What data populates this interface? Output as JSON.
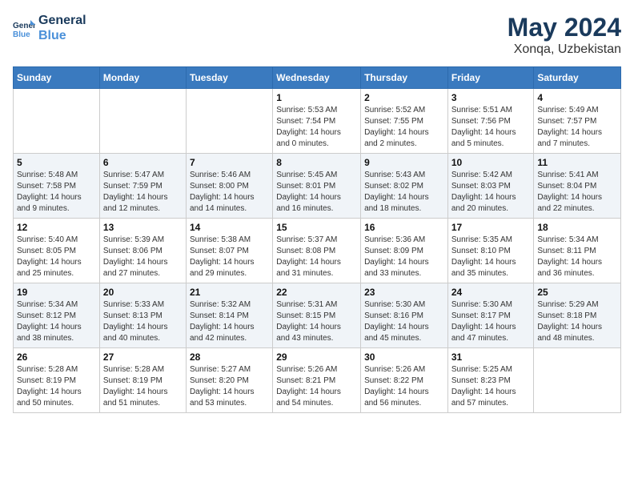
{
  "header": {
    "logo_line1": "General",
    "logo_line2": "Blue",
    "month": "May 2024",
    "location": "Xonqa, Uzbekistan"
  },
  "days_of_week": [
    "Sunday",
    "Monday",
    "Tuesday",
    "Wednesday",
    "Thursday",
    "Friday",
    "Saturday"
  ],
  "weeks": [
    [
      {
        "day": "",
        "info": ""
      },
      {
        "day": "",
        "info": ""
      },
      {
        "day": "",
        "info": ""
      },
      {
        "day": "1",
        "info": "Sunrise: 5:53 AM\nSunset: 7:54 PM\nDaylight: 14 hours\nand 0 minutes."
      },
      {
        "day": "2",
        "info": "Sunrise: 5:52 AM\nSunset: 7:55 PM\nDaylight: 14 hours\nand 2 minutes."
      },
      {
        "day": "3",
        "info": "Sunrise: 5:51 AM\nSunset: 7:56 PM\nDaylight: 14 hours\nand 5 minutes."
      },
      {
        "day": "4",
        "info": "Sunrise: 5:49 AM\nSunset: 7:57 PM\nDaylight: 14 hours\nand 7 minutes."
      }
    ],
    [
      {
        "day": "5",
        "info": "Sunrise: 5:48 AM\nSunset: 7:58 PM\nDaylight: 14 hours\nand 9 minutes."
      },
      {
        "day": "6",
        "info": "Sunrise: 5:47 AM\nSunset: 7:59 PM\nDaylight: 14 hours\nand 12 minutes."
      },
      {
        "day": "7",
        "info": "Sunrise: 5:46 AM\nSunset: 8:00 PM\nDaylight: 14 hours\nand 14 minutes."
      },
      {
        "day": "8",
        "info": "Sunrise: 5:45 AM\nSunset: 8:01 PM\nDaylight: 14 hours\nand 16 minutes."
      },
      {
        "day": "9",
        "info": "Sunrise: 5:43 AM\nSunset: 8:02 PM\nDaylight: 14 hours\nand 18 minutes."
      },
      {
        "day": "10",
        "info": "Sunrise: 5:42 AM\nSunset: 8:03 PM\nDaylight: 14 hours\nand 20 minutes."
      },
      {
        "day": "11",
        "info": "Sunrise: 5:41 AM\nSunset: 8:04 PM\nDaylight: 14 hours\nand 22 minutes."
      }
    ],
    [
      {
        "day": "12",
        "info": "Sunrise: 5:40 AM\nSunset: 8:05 PM\nDaylight: 14 hours\nand 25 minutes."
      },
      {
        "day": "13",
        "info": "Sunrise: 5:39 AM\nSunset: 8:06 PM\nDaylight: 14 hours\nand 27 minutes."
      },
      {
        "day": "14",
        "info": "Sunrise: 5:38 AM\nSunset: 8:07 PM\nDaylight: 14 hours\nand 29 minutes."
      },
      {
        "day": "15",
        "info": "Sunrise: 5:37 AM\nSunset: 8:08 PM\nDaylight: 14 hours\nand 31 minutes."
      },
      {
        "day": "16",
        "info": "Sunrise: 5:36 AM\nSunset: 8:09 PM\nDaylight: 14 hours\nand 33 minutes."
      },
      {
        "day": "17",
        "info": "Sunrise: 5:35 AM\nSunset: 8:10 PM\nDaylight: 14 hours\nand 35 minutes."
      },
      {
        "day": "18",
        "info": "Sunrise: 5:34 AM\nSunset: 8:11 PM\nDaylight: 14 hours\nand 36 minutes."
      }
    ],
    [
      {
        "day": "19",
        "info": "Sunrise: 5:34 AM\nSunset: 8:12 PM\nDaylight: 14 hours\nand 38 minutes."
      },
      {
        "day": "20",
        "info": "Sunrise: 5:33 AM\nSunset: 8:13 PM\nDaylight: 14 hours\nand 40 minutes."
      },
      {
        "day": "21",
        "info": "Sunrise: 5:32 AM\nSunset: 8:14 PM\nDaylight: 14 hours\nand 42 minutes."
      },
      {
        "day": "22",
        "info": "Sunrise: 5:31 AM\nSunset: 8:15 PM\nDaylight: 14 hours\nand 43 minutes."
      },
      {
        "day": "23",
        "info": "Sunrise: 5:30 AM\nSunset: 8:16 PM\nDaylight: 14 hours\nand 45 minutes."
      },
      {
        "day": "24",
        "info": "Sunrise: 5:30 AM\nSunset: 8:17 PM\nDaylight: 14 hours\nand 47 minutes."
      },
      {
        "day": "25",
        "info": "Sunrise: 5:29 AM\nSunset: 8:18 PM\nDaylight: 14 hours\nand 48 minutes."
      }
    ],
    [
      {
        "day": "26",
        "info": "Sunrise: 5:28 AM\nSunset: 8:19 PM\nDaylight: 14 hours\nand 50 minutes."
      },
      {
        "day": "27",
        "info": "Sunrise: 5:28 AM\nSunset: 8:19 PM\nDaylight: 14 hours\nand 51 minutes."
      },
      {
        "day": "28",
        "info": "Sunrise: 5:27 AM\nSunset: 8:20 PM\nDaylight: 14 hours\nand 53 minutes."
      },
      {
        "day": "29",
        "info": "Sunrise: 5:26 AM\nSunset: 8:21 PM\nDaylight: 14 hours\nand 54 minutes."
      },
      {
        "day": "30",
        "info": "Sunrise: 5:26 AM\nSunset: 8:22 PM\nDaylight: 14 hours\nand 56 minutes."
      },
      {
        "day": "31",
        "info": "Sunrise: 5:25 AM\nSunset: 8:23 PM\nDaylight: 14 hours\nand 57 minutes."
      },
      {
        "day": "",
        "info": ""
      }
    ]
  ]
}
